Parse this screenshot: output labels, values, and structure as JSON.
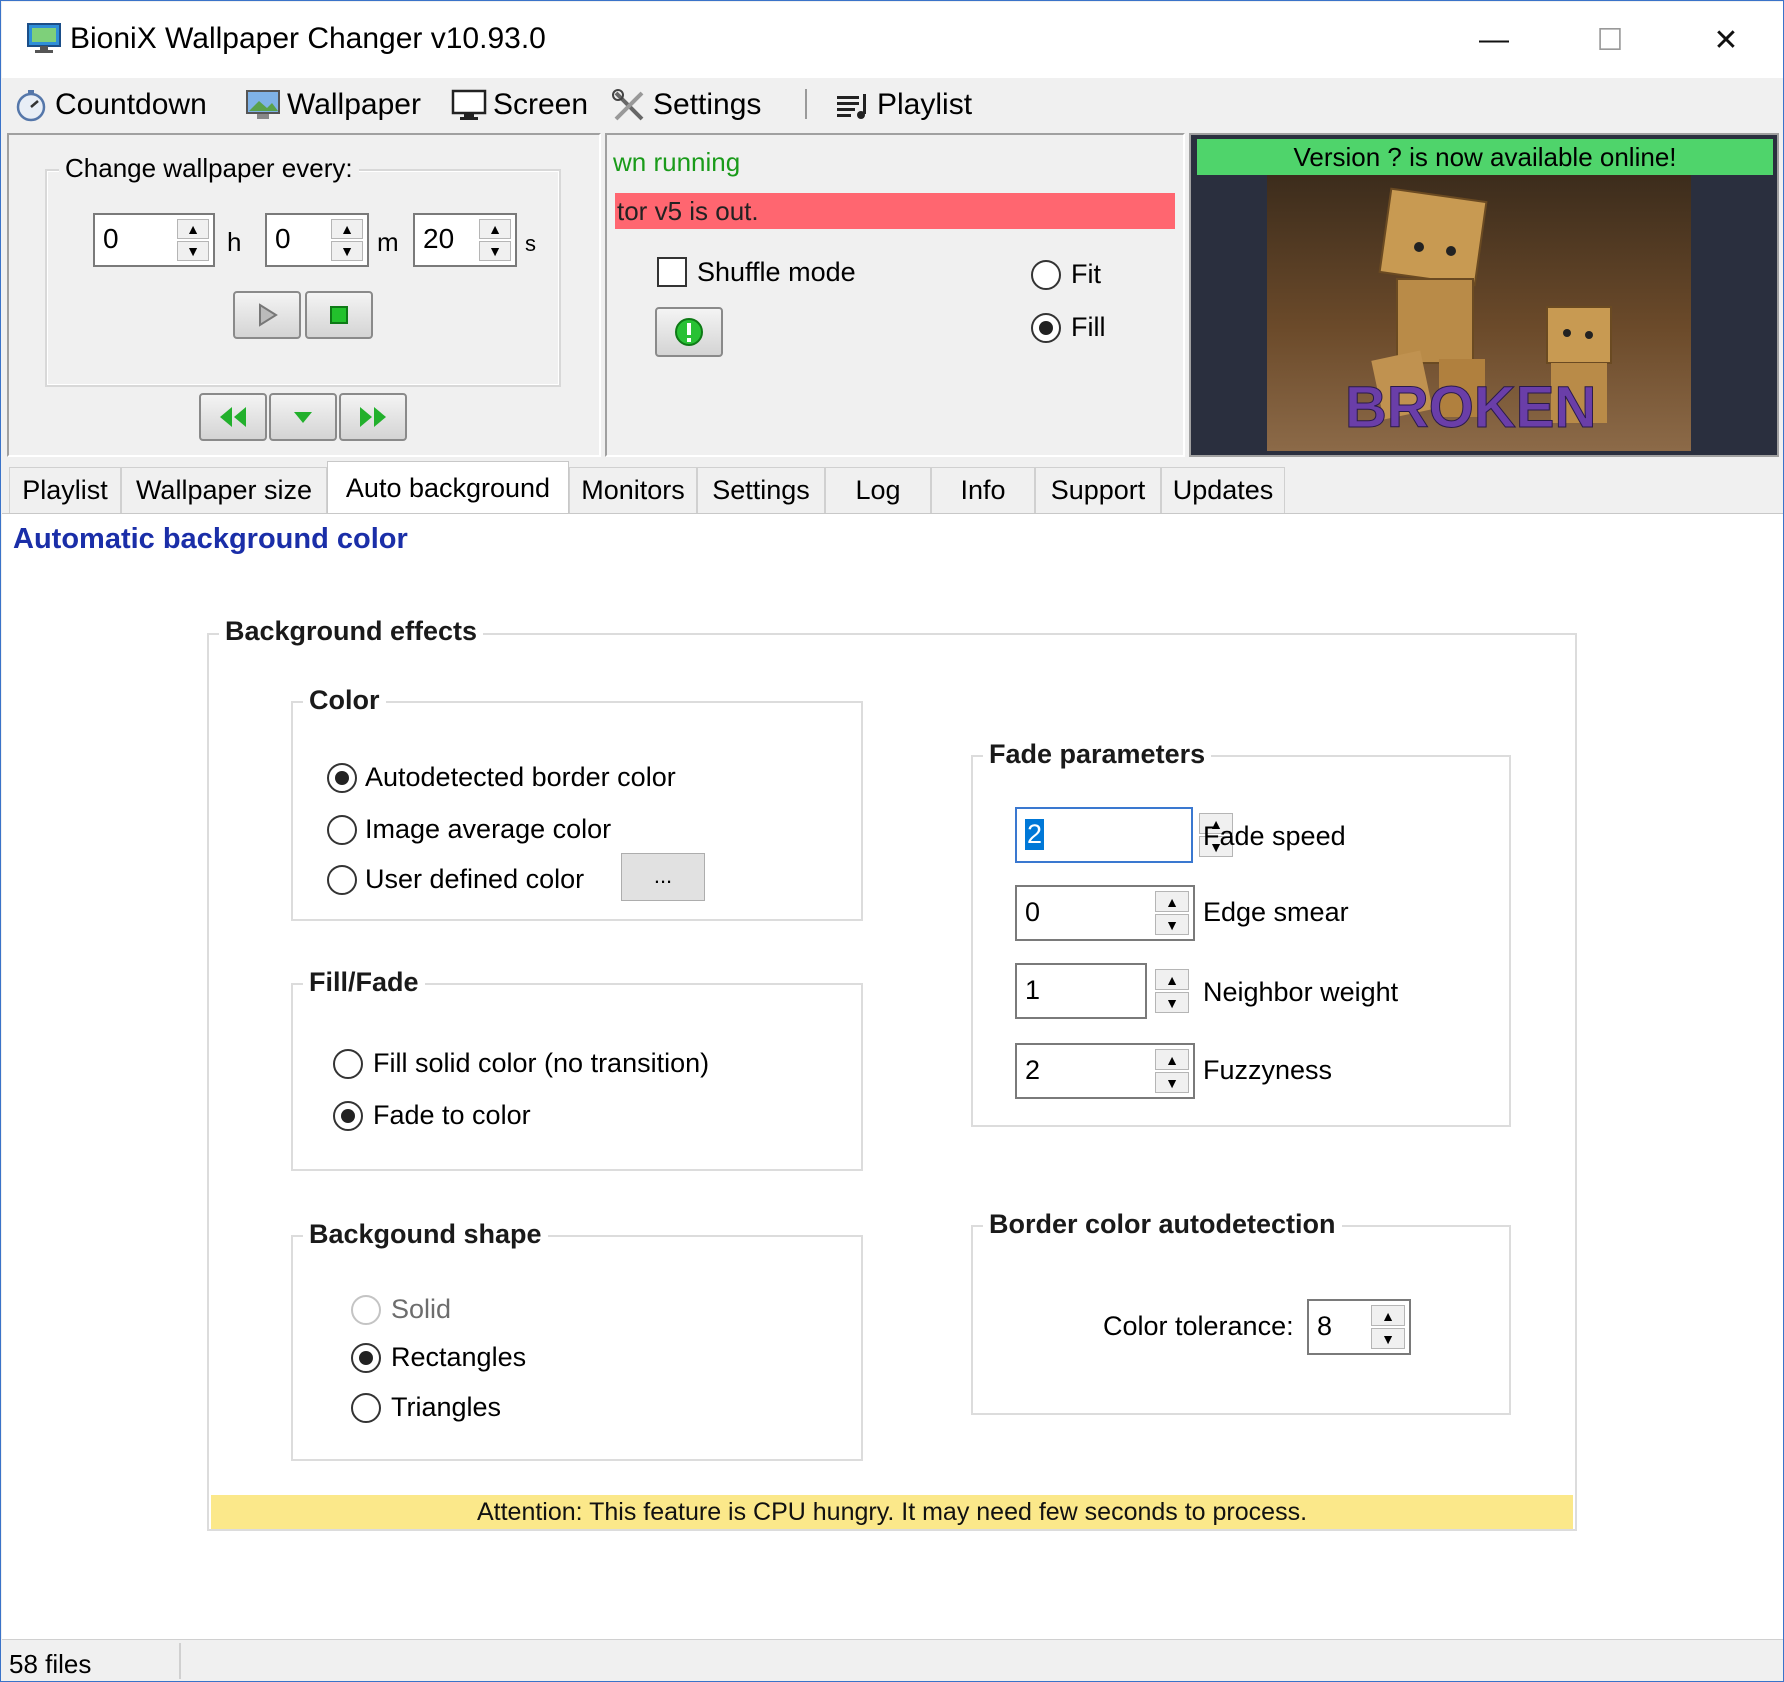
{
  "window": {
    "title": "BioniX Wallpaper Changer v10.93.0",
    "minimize": "—",
    "maximize": "☐",
    "close": "✕"
  },
  "menu": {
    "items": [
      {
        "label": "Countdown",
        "icon": "stopwatch-icon"
      },
      {
        "label": "Wallpaper",
        "icon": "wallpaper-icon"
      },
      {
        "label": "Screen",
        "icon": "monitor-icon"
      },
      {
        "label": "Settings",
        "icon": "tools-icon"
      },
      {
        "label": "Playlist",
        "icon": "playlist-icon"
      }
    ]
  },
  "countdown": {
    "group_label": "Change wallpaper every:",
    "hours": "0",
    "minutes": "0",
    "seconds": "20",
    "unit_h": "h",
    "unit_m": "m",
    "unit_s": "s"
  },
  "status": {
    "running_text": "wn running",
    "alert_text": "tor v5 is out.",
    "running_color": "#1a9b1a",
    "alert_bg": "#ff6670"
  },
  "options": {
    "shuffle_label": "Shuffle mode",
    "shuffle_checked": false,
    "fit_label": "Fit",
    "fill_label": "Fill",
    "selected": "Fill"
  },
  "preview": {
    "banner_text": "Version ? is now available online!",
    "banner_bg": "#4fd46b",
    "image_caption": "BROKEN"
  },
  "tabs": [
    "Playlist",
    "Wallpaper size",
    "Auto background",
    "Monitors",
    "Settings",
    "Log",
    "Info",
    "Support",
    "Updates"
  ],
  "active_tab": "Auto background",
  "auto_background": {
    "title": "Automatic background color",
    "effects_label": "Background  effects",
    "color": {
      "label": "Color",
      "options": [
        "Autodetected border color",
        "Image average color",
        "User defined color"
      ],
      "selected": 0,
      "picker_label": "..."
    },
    "fill_fade": {
      "label": "Fill/Fade",
      "options": [
        "Fill solid color (no transition)",
        "Fade to color"
      ],
      "selected": 1
    },
    "shape": {
      "label": "Backgound shape",
      "options": [
        "Solid",
        "Rectangles",
        "Triangles"
      ],
      "selected": 1
    },
    "fade": {
      "label": "Fade parameters",
      "fields": [
        {
          "label": "Fade speed",
          "value": "2"
        },
        {
          "label": "Edge smear",
          "value": "0"
        },
        {
          "label": "Neighbor weight",
          "value": "1"
        },
        {
          "label": "Fuzzyness",
          "value": "2"
        }
      ]
    },
    "border": {
      "label": "Border color autodetection",
      "tolerance_label": "Color tolerance:",
      "tolerance_value": "8"
    },
    "attention": "Attention: This feature is CPU hungry. It may need few seconds to process.",
    "attention_bg": "#fbe88a"
  },
  "statusbar": {
    "files": "58 files"
  }
}
